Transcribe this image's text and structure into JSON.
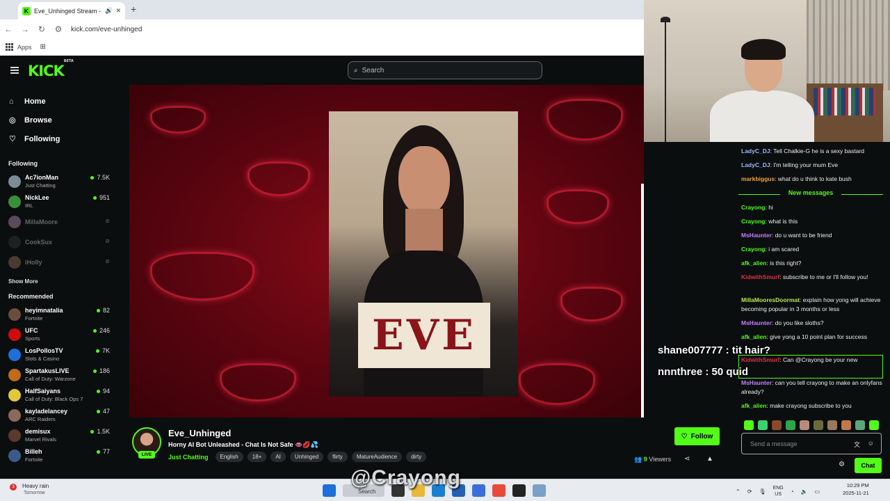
{
  "browser": {
    "tab_title": "Eve_Unhinged Stream - Wa",
    "url": "kick.com/eve-unhinged",
    "bookmark_apps": "Apps"
  },
  "header": {
    "logo": "KICK",
    "logo_sup": "BETA",
    "search_placeholder": "Search"
  },
  "sidebar": {
    "nav": [
      {
        "label": "Home",
        "icon": "home-icon"
      },
      {
        "label": "Browse",
        "icon": "compass-icon"
      },
      {
        "label": "Following",
        "icon": "heart-icon"
      }
    ],
    "following_title": "Following",
    "following": [
      {
        "name": "Ac7ionMan",
        "sub": "Just Chatting",
        "count": "7.5K",
        "color": "#7d8b95"
      },
      {
        "name": "NickLee",
        "sub": "IRL",
        "count": "951",
        "color": "#3a8f3a"
      },
      {
        "name": "MillaMoore",
        "offline": true,
        "color": "#aa88aa"
      },
      {
        "name": "CookSux",
        "offline": true,
        "color": "#333333"
      },
      {
        "name": "iHolly",
        "offline": true,
        "color": "#886655"
      }
    ],
    "show_more": "Show More",
    "recommended_title": "Recommended",
    "recommended": [
      {
        "name": "heyimnatalia",
        "sub": "Fortnite",
        "count": "82",
        "color": "#6a4d3a"
      },
      {
        "name": "UFC",
        "sub": "Sports",
        "count": "246",
        "color": "#d20a0a"
      },
      {
        "name": "LosPollosTV",
        "sub": "Slots & Casino",
        "count": "7K",
        "color": "#1e6fd9"
      },
      {
        "name": "SpartakusLIVE",
        "sub": "Call of Duty: Warzone",
        "count": "186",
        "color": "#c06b1a"
      },
      {
        "name": "HalfSaiyans",
        "sub": "Call of Duty: Black Ops 7",
        "count": "94",
        "color": "#e2c73a"
      },
      {
        "name": "kayladelancey",
        "sub": "ARC Raiders",
        "count": "47",
        "color": "#8a6a5a"
      },
      {
        "name": "demisux",
        "sub": "Marvel Rivals",
        "count": "1.5K",
        "color": "#5a3a2a"
      },
      {
        "name": "Billeh",
        "sub": "Fortnite",
        "count": "77",
        "color": "#3a5a8a"
      }
    ]
  },
  "video": {
    "poster_text": "EVE"
  },
  "overlay": {
    "donation_1": "shane007777 : tit hair?",
    "donation_2": "nnnthree : 50 quid",
    "watermark": "@Crayong"
  },
  "chat": {
    "messages_before": [
      {
        "user": "LadyC_DJ",
        "text": ": Tell Chalkie-G he is a sexy bastard",
        "color": "#9db7ff"
      },
      {
        "user": "LadyC_DJ",
        "text": ": I'm telling your mum Eve",
        "color": "#9db7ff"
      },
      {
        "user": "markbiggus",
        "text": ": what do u think to kate bush",
        "color": "#f2a33a"
      }
    ],
    "new_messages_label": "New messages",
    "messages_after": [
      {
        "user": "Crayong",
        "text": ": hi",
        "color": "#53fc18"
      },
      {
        "user": "Crayong",
        "text": ": what is this",
        "color": "#53fc18"
      },
      {
        "user": "MsHaunter",
        "text": ": do u want to be friend",
        "color": "#c77dff"
      },
      {
        "user": "Crayong",
        "text": ": i am scared",
        "color": "#53fc18"
      },
      {
        "user": "afk_alien",
        "text": ": is this right?",
        "color": "#53fc18"
      },
      {
        "user": "KidwithSmurf",
        "text": ": subscribe to me or I'll follow you!",
        "color": "#e0304a"
      },
      {
        "user": "MillaMooresDoormat",
        "text": ": explain how yong will achieve becoming popular in 3 months or less",
        "color": "#b5e85a"
      },
      {
        "user": "MsHaunter",
        "text": ": do you like sloths?",
        "color": "#c77dff"
      },
      {
        "user": "afk_alien",
        "text": ": give yong a 10 point plan for success",
        "color": "#53fc18"
      },
      {
        "user": "KidwithSmurf",
        "text": ": Can @Crayong be your new",
        "color": "#e0304a"
      },
      {
        "user": "MsHaunter",
        "text": ": can you tell crayong to make an onlyfans already?",
        "color": "#c77dff"
      },
      {
        "user": "afk_alien",
        "text": ": make crayong subscribe to you",
        "color": "#53fc18"
      }
    ],
    "input_placeholder": "Send a message",
    "chat_button": "Chat"
  },
  "stream": {
    "name": "Eve_Unhinged",
    "live_badge": "LIVE",
    "title": "Horny AI Bot Unleashed - Chat Is Not Safe 👄💋💦",
    "category": "Just Chatting",
    "tags": [
      "English",
      "18+",
      "AI",
      "Unhinged",
      "flirty",
      "MatureAudience",
      "dirty"
    ],
    "follow_label": "Follow",
    "viewers_count": "9",
    "viewers_label": "Viewers"
  },
  "taskbar": {
    "weather": "Heavy rain",
    "weather_sub": "Tomorrow",
    "weather_badge": "3",
    "search": "Search",
    "lang": "ENG",
    "region": "US",
    "time": "10:29 PM",
    "date": "2025-11-21"
  }
}
